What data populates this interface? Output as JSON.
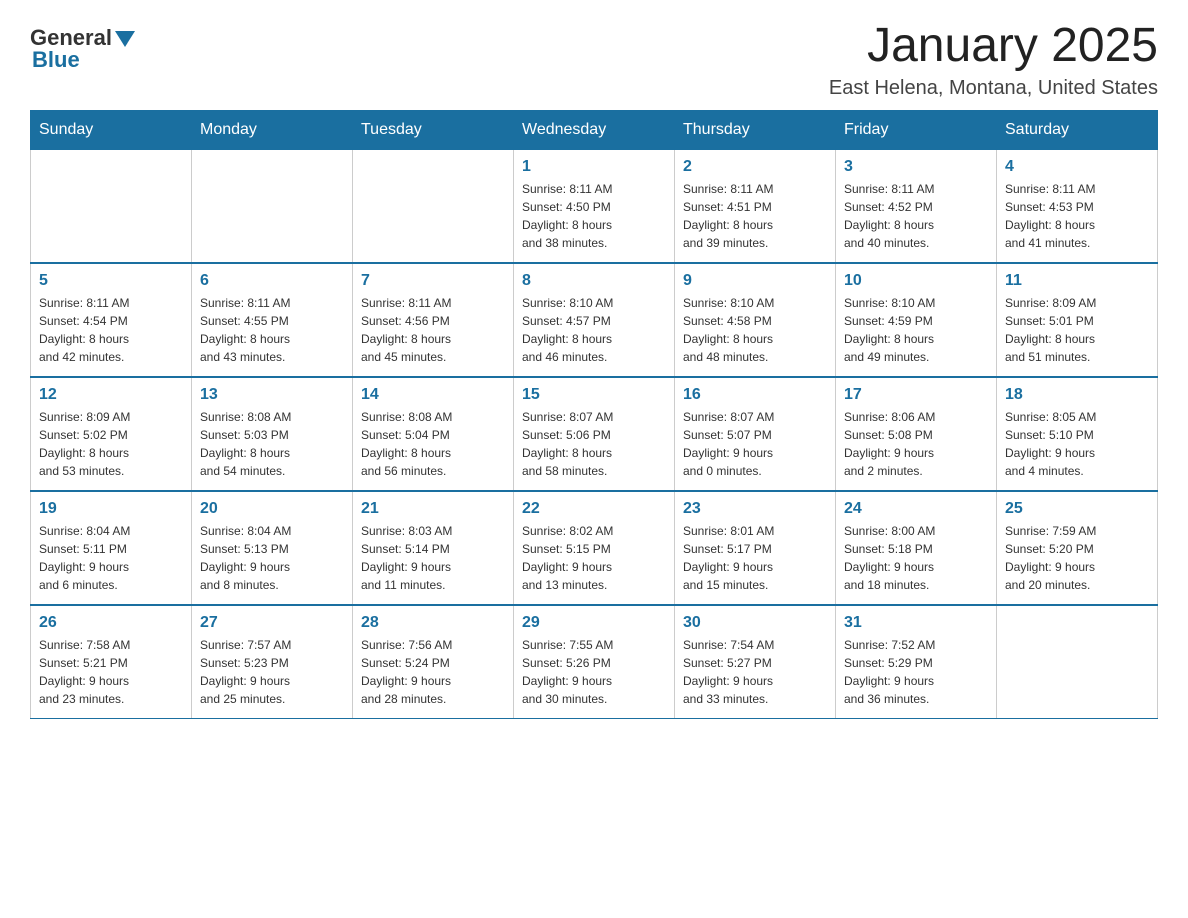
{
  "logo": {
    "general": "General",
    "blue": "Blue"
  },
  "header": {
    "title": "January 2025",
    "subtitle": "East Helena, Montana, United States"
  },
  "days_of_week": [
    "Sunday",
    "Monday",
    "Tuesday",
    "Wednesday",
    "Thursday",
    "Friday",
    "Saturday"
  ],
  "weeks": [
    [
      {
        "day": "",
        "info": ""
      },
      {
        "day": "",
        "info": ""
      },
      {
        "day": "",
        "info": ""
      },
      {
        "day": "1",
        "info": "Sunrise: 8:11 AM\nSunset: 4:50 PM\nDaylight: 8 hours\nand 38 minutes."
      },
      {
        "day": "2",
        "info": "Sunrise: 8:11 AM\nSunset: 4:51 PM\nDaylight: 8 hours\nand 39 minutes."
      },
      {
        "day": "3",
        "info": "Sunrise: 8:11 AM\nSunset: 4:52 PM\nDaylight: 8 hours\nand 40 minutes."
      },
      {
        "day": "4",
        "info": "Sunrise: 8:11 AM\nSunset: 4:53 PM\nDaylight: 8 hours\nand 41 minutes."
      }
    ],
    [
      {
        "day": "5",
        "info": "Sunrise: 8:11 AM\nSunset: 4:54 PM\nDaylight: 8 hours\nand 42 minutes."
      },
      {
        "day": "6",
        "info": "Sunrise: 8:11 AM\nSunset: 4:55 PM\nDaylight: 8 hours\nand 43 minutes."
      },
      {
        "day": "7",
        "info": "Sunrise: 8:11 AM\nSunset: 4:56 PM\nDaylight: 8 hours\nand 45 minutes."
      },
      {
        "day": "8",
        "info": "Sunrise: 8:10 AM\nSunset: 4:57 PM\nDaylight: 8 hours\nand 46 minutes."
      },
      {
        "day": "9",
        "info": "Sunrise: 8:10 AM\nSunset: 4:58 PM\nDaylight: 8 hours\nand 48 minutes."
      },
      {
        "day": "10",
        "info": "Sunrise: 8:10 AM\nSunset: 4:59 PM\nDaylight: 8 hours\nand 49 minutes."
      },
      {
        "day": "11",
        "info": "Sunrise: 8:09 AM\nSunset: 5:01 PM\nDaylight: 8 hours\nand 51 minutes."
      }
    ],
    [
      {
        "day": "12",
        "info": "Sunrise: 8:09 AM\nSunset: 5:02 PM\nDaylight: 8 hours\nand 53 minutes."
      },
      {
        "day": "13",
        "info": "Sunrise: 8:08 AM\nSunset: 5:03 PM\nDaylight: 8 hours\nand 54 minutes."
      },
      {
        "day": "14",
        "info": "Sunrise: 8:08 AM\nSunset: 5:04 PM\nDaylight: 8 hours\nand 56 minutes."
      },
      {
        "day": "15",
        "info": "Sunrise: 8:07 AM\nSunset: 5:06 PM\nDaylight: 8 hours\nand 58 minutes."
      },
      {
        "day": "16",
        "info": "Sunrise: 8:07 AM\nSunset: 5:07 PM\nDaylight: 9 hours\nand 0 minutes."
      },
      {
        "day": "17",
        "info": "Sunrise: 8:06 AM\nSunset: 5:08 PM\nDaylight: 9 hours\nand 2 minutes."
      },
      {
        "day": "18",
        "info": "Sunrise: 8:05 AM\nSunset: 5:10 PM\nDaylight: 9 hours\nand 4 minutes."
      }
    ],
    [
      {
        "day": "19",
        "info": "Sunrise: 8:04 AM\nSunset: 5:11 PM\nDaylight: 9 hours\nand 6 minutes."
      },
      {
        "day": "20",
        "info": "Sunrise: 8:04 AM\nSunset: 5:13 PM\nDaylight: 9 hours\nand 8 minutes."
      },
      {
        "day": "21",
        "info": "Sunrise: 8:03 AM\nSunset: 5:14 PM\nDaylight: 9 hours\nand 11 minutes."
      },
      {
        "day": "22",
        "info": "Sunrise: 8:02 AM\nSunset: 5:15 PM\nDaylight: 9 hours\nand 13 minutes."
      },
      {
        "day": "23",
        "info": "Sunrise: 8:01 AM\nSunset: 5:17 PM\nDaylight: 9 hours\nand 15 minutes."
      },
      {
        "day": "24",
        "info": "Sunrise: 8:00 AM\nSunset: 5:18 PM\nDaylight: 9 hours\nand 18 minutes."
      },
      {
        "day": "25",
        "info": "Sunrise: 7:59 AM\nSunset: 5:20 PM\nDaylight: 9 hours\nand 20 minutes."
      }
    ],
    [
      {
        "day": "26",
        "info": "Sunrise: 7:58 AM\nSunset: 5:21 PM\nDaylight: 9 hours\nand 23 minutes."
      },
      {
        "day": "27",
        "info": "Sunrise: 7:57 AM\nSunset: 5:23 PM\nDaylight: 9 hours\nand 25 minutes."
      },
      {
        "day": "28",
        "info": "Sunrise: 7:56 AM\nSunset: 5:24 PM\nDaylight: 9 hours\nand 28 minutes."
      },
      {
        "day": "29",
        "info": "Sunrise: 7:55 AM\nSunset: 5:26 PM\nDaylight: 9 hours\nand 30 minutes."
      },
      {
        "day": "30",
        "info": "Sunrise: 7:54 AM\nSunset: 5:27 PM\nDaylight: 9 hours\nand 33 minutes."
      },
      {
        "day": "31",
        "info": "Sunrise: 7:52 AM\nSunset: 5:29 PM\nDaylight: 9 hours\nand 36 minutes."
      },
      {
        "day": "",
        "info": ""
      }
    ]
  ]
}
